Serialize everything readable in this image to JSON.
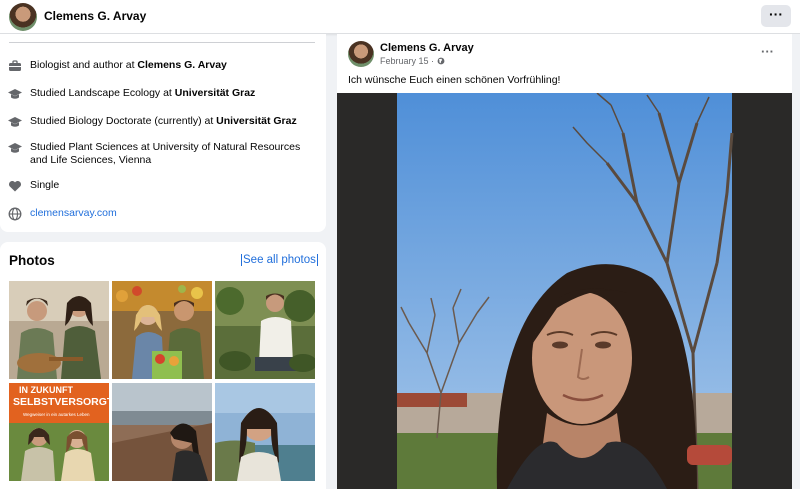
{
  "header": {
    "profile_name": "Clemens G. Arvay",
    "more_label": "···"
  },
  "intro": {
    "items": [
      {
        "icon": "briefcase-icon",
        "text": "Biologist and author at ",
        "bold": "Clemens G. Arvay"
      },
      {
        "icon": "graduation-cap-icon",
        "text": "Studied Landscape Ecology at ",
        "bold": "Universität Graz"
      },
      {
        "icon": "graduation-cap-icon",
        "text": "Studied Biology Doctorate (currently) at ",
        "bold": "Universität Graz"
      },
      {
        "icon": "graduation-cap-icon",
        "text": "Studied Plant Sciences at University of Natural Resources and Life Sciences, Vienna",
        "bold": ""
      },
      {
        "icon": "heart-icon",
        "text": "Single",
        "bold": ""
      },
      {
        "icon": "globe-icon",
        "text": "clemensarvay.com",
        "bold": ""
      }
    ]
  },
  "photos": {
    "title": "Photos",
    "see_all": "See all photos",
    "book_text_line1": "IN ZUKUNFT",
    "book_text_line2": "SELBSTVERSORGT",
    "book_subtitle": "Wegweiser in ein autarkes Leben"
  },
  "post": {
    "author": "Clemens G. Arvay",
    "date": "February 15",
    "privacy_separator": " · ",
    "text": "Ich wünsche Euch einen schönen Vorfrühling!",
    "more_label": "···"
  }
}
